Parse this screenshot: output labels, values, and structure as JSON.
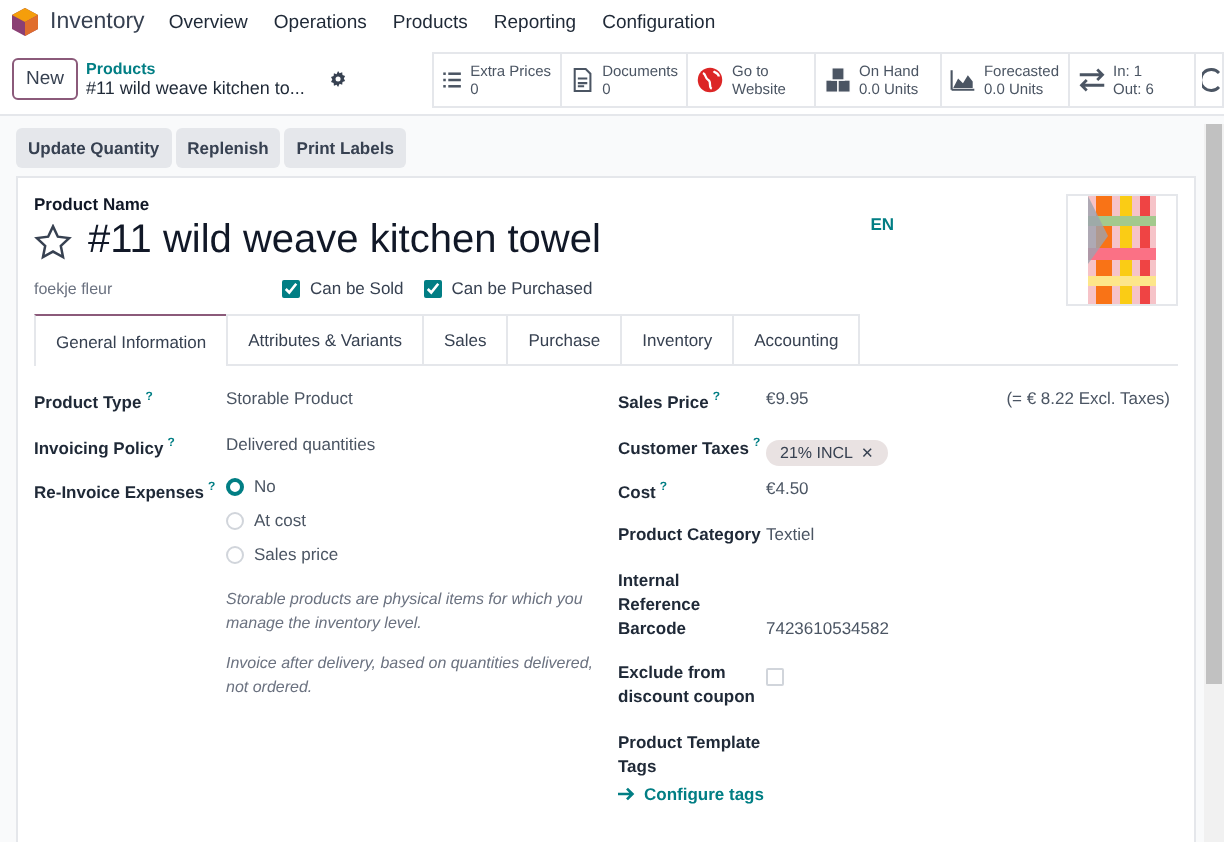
{
  "app": {
    "name": "Inventory"
  },
  "menu": [
    "Overview",
    "Operations",
    "Products",
    "Reporting",
    "Configuration"
  ],
  "control": {
    "new_button": "New",
    "breadcrumb": "Products",
    "record": "#11 wild weave kitchen to..."
  },
  "stats": [
    {
      "kind": "list",
      "line1": "Extra Prices",
      "line2": "0"
    },
    {
      "kind": "document",
      "line1": "Documents",
      "line2": "0"
    },
    {
      "kind": "globe",
      "line1": "Go to",
      "line2": "Website"
    },
    {
      "kind": "boxes",
      "line1": "On Hand",
      "line2": "0.0 Units"
    },
    {
      "kind": "chart",
      "line1": "Forecasted",
      "line2": "0.0 Units"
    },
    {
      "kind": "arrows",
      "line1": "In: 1",
      "line2": "Out: 6"
    }
  ],
  "actions": [
    "Update Quantity",
    "Replenish",
    "Print Labels"
  ],
  "product": {
    "name_label": "Product Name",
    "name": "#11 wild weave kitchen towel",
    "favorite": false,
    "language": "EN",
    "company": "foekje fleur",
    "flags": [
      {
        "label": "Can be Sold",
        "checked": true
      },
      {
        "label": "Can be Purchased",
        "checked": true
      }
    ]
  },
  "tabs": [
    {
      "label": "General Information",
      "selected": true
    },
    {
      "label": "Attributes & Variants",
      "selected": false
    },
    {
      "label": "Sales",
      "selected": false
    },
    {
      "label": "Purchase",
      "selected": false
    },
    {
      "label": "Inventory",
      "selected": false
    },
    {
      "label": "Accounting",
      "selected": false
    }
  ],
  "left_fields": [
    {
      "label": "Product Type",
      "help": "?",
      "value": "Storable Product"
    },
    {
      "label": "Invoicing Policy",
      "help": "?",
      "value": "Delivered quantities"
    }
  ],
  "reinvoice": {
    "label": "Re-Invoice Expenses",
    "help": "?",
    "options": [
      {
        "label": "No",
        "selected": true
      },
      {
        "label": "At cost",
        "selected": false
      },
      {
        "label": "Sales price",
        "selected": false
      }
    ]
  },
  "notes": [
    "Storable products are physical items for which you manage the inventory level.",
    "Invoice after delivery, based on quantities delivered, not ordered."
  ],
  "right_fields": [
    {
      "kind": "text",
      "label": "Sales Price",
      "help": "?",
      "value": "€9.95",
      "extra": "(= € 8.22 Excl. Taxes)"
    },
    {
      "kind": "tag",
      "label": "Customer Taxes",
      "help": "?",
      "value": "21% INCL",
      "remove": "✕"
    },
    {
      "kind": "text",
      "label": "Cost",
      "help": "?",
      "value": "€4.50"
    },
    {
      "kind": "text",
      "label": "Product Category",
      "value": "Textiel"
    },
    {
      "kind": "text",
      "label": "Internal Reference"
    },
    {
      "kind": "text",
      "label": "Barcode",
      "value": "7423610534582"
    },
    {
      "kind": "checkbox",
      "label": "Exclude from discount coupon",
      "checked": false
    },
    {
      "kind": "text",
      "label": "Product Template Tags"
    }
  ],
  "configure_link": "Configure tags"
}
